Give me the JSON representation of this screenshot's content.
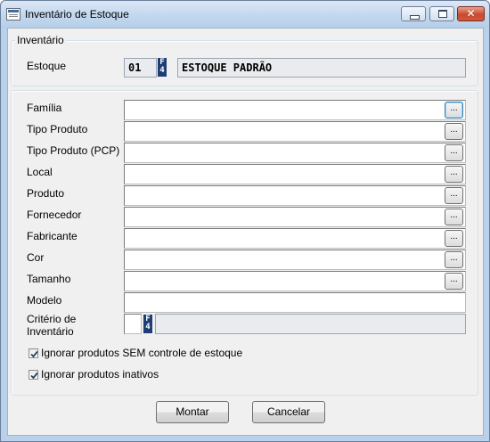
{
  "window": {
    "title": "Inventário de Estoque",
    "close_glyph": "✕"
  },
  "inventario": {
    "group_title": "Inventário",
    "estoque_label": "Estoque",
    "estoque_code": "01",
    "estoque_lookup_key": "F4",
    "estoque_name": "ESTOQUE PADRÃO"
  },
  "filters": {
    "familia": "Família",
    "tipo_produto": "Tipo Produto",
    "tipo_produto_pcp": "Tipo Produto (PCP)",
    "local": "Local",
    "produto": "Produto",
    "fornecedor": "Fornecedor",
    "fabricante": "Fabricante",
    "cor": "Cor",
    "tamanho": "Tamanho",
    "modelo": "Modelo",
    "criterio": "Critério de Inventário",
    "criterio_lookup_key": "F4",
    "ellipsis": "..."
  },
  "options": {
    "ignorar_sem_controle": {
      "label": "Ignorar produtos SEM controle de estoque",
      "checked": true
    },
    "ignorar_inativos": {
      "label": "Ignorar produtos inativos",
      "checked": true
    }
  },
  "buttons": {
    "montar": "Montar",
    "cancelar": "Cancelar"
  }
}
